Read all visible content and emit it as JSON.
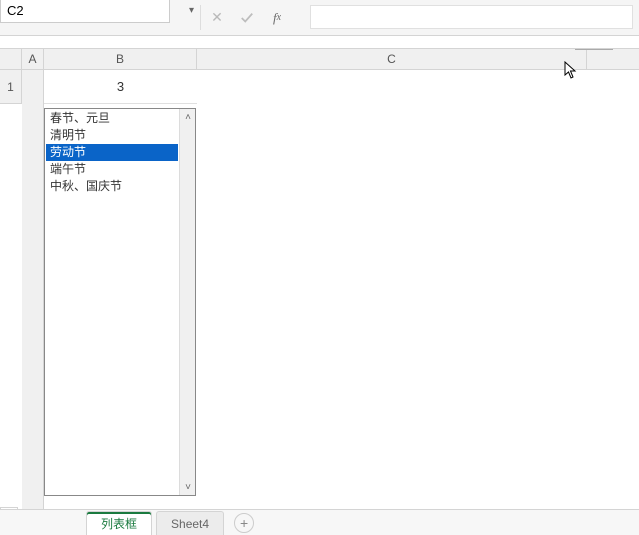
{
  "formulaBar": {
    "nameBoxValue": "C2",
    "fxLabel": "fx",
    "formulaValue": ""
  },
  "columns": {
    "A": "A",
    "B": "B",
    "C": "C"
  },
  "rows": {
    "r1": "1"
  },
  "cells": {
    "B1": "3"
  },
  "listbox": {
    "items": [
      "春节、元旦",
      "清明节",
      "劳动节",
      "端午节",
      "中秋、国庆节"
    ],
    "selectedIndex": 2
  },
  "tabs": {
    "active": "列表框",
    "inactive": "Sheet4"
  }
}
